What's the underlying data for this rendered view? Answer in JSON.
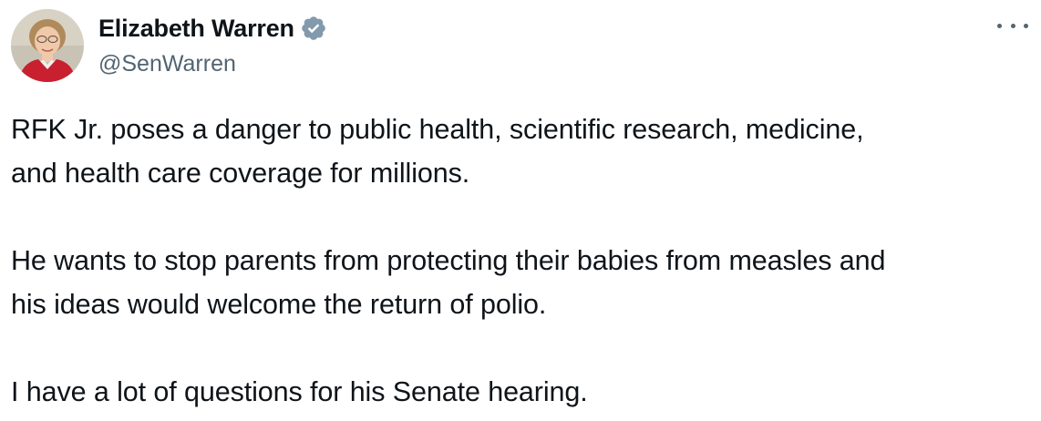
{
  "tweet": {
    "author": {
      "name": "Elizabeth Warren",
      "handle": "@SenWarren",
      "verified": true,
      "verified_color": "#829aab"
    },
    "paragraphs": [
      {
        "lines": [
          "RFK Jr. poses a danger to public health, scientific research, medicine,",
          "and health care coverage for millions."
        ]
      },
      {
        "lines": [
          "He wants to stop parents from protecting their babies from measles and",
          "his ideas would welcome the return of polio."
        ]
      },
      {
        "lines": [
          "I have a lot of questions for his Senate hearing."
        ]
      }
    ],
    "icons": {
      "verified": "verified-badge-icon",
      "more": "more-options-icon"
    }
  }
}
